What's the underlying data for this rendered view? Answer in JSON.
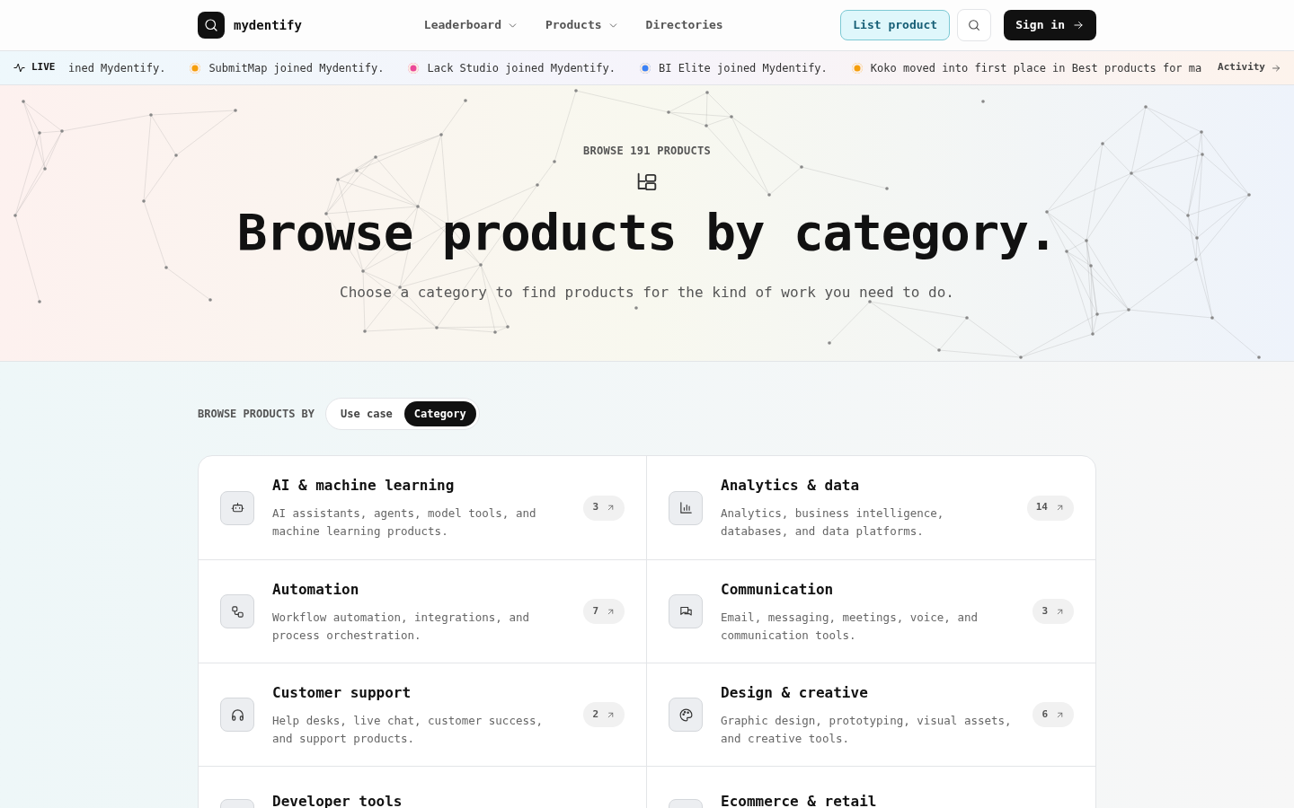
{
  "header": {
    "logo": "mydentify",
    "nav": [
      {
        "label": "Leaderboard",
        "dropdown": true
      },
      {
        "label": "Products",
        "dropdown": true
      },
      {
        "label": "Directories",
        "dropdown": false
      }
    ],
    "list_button": "List product",
    "sign_in": "Sign in"
  },
  "ticker": {
    "label": "LIVE",
    "items": [
      {
        "text": "ined Mydentify."
      },
      {
        "text": "SubmitMap joined Mydentify.",
        "color": "#f59e0b"
      },
      {
        "text": "Lack Studio joined Mydentify.",
        "color": "#ec4899"
      },
      {
        "text": "BI Elite joined Mydentify.",
        "color": "#3b82f6"
      },
      {
        "text": "Koko moved into first place in Best products for ma",
        "color": "#f59e0b"
      }
    ],
    "activity": "Activity"
  },
  "hero": {
    "eyebrow": "BROWSE 191 PRODUCTS",
    "title": "Browse products by category.",
    "subtitle": "Choose a category to find products for the kind of work you need to do."
  },
  "browse_by": {
    "label": "BROWSE PRODUCTS BY",
    "options": [
      {
        "label": "Use case",
        "selected": false
      },
      {
        "label": "Category",
        "selected": true
      }
    ]
  },
  "categories": [
    {
      "title": "AI & machine learning",
      "description": "AI assistants, agents, model tools, and machine learning products.",
      "count": "3"
    },
    {
      "title": "Analytics & data",
      "description": "Analytics, business intelligence, databases, and data platforms.",
      "count": "14"
    },
    {
      "title": "Automation",
      "description": "Workflow automation, integrations, and process orchestration.",
      "count": "7"
    },
    {
      "title": "Communication",
      "description": "Email, messaging, meetings, voice, and communication tools.",
      "count": "3"
    },
    {
      "title": "Customer support",
      "description": "Help desks, live chat, customer success, and support products.",
      "count": "2"
    },
    {
      "title": "Design & creative",
      "description": "Graphic design, prototyping, visual assets, and creative tools.",
      "count": "6"
    },
    {
      "title": "Developer tools"
    },
    {
      "title": "Ecommerce & retail"
    }
  ]
}
